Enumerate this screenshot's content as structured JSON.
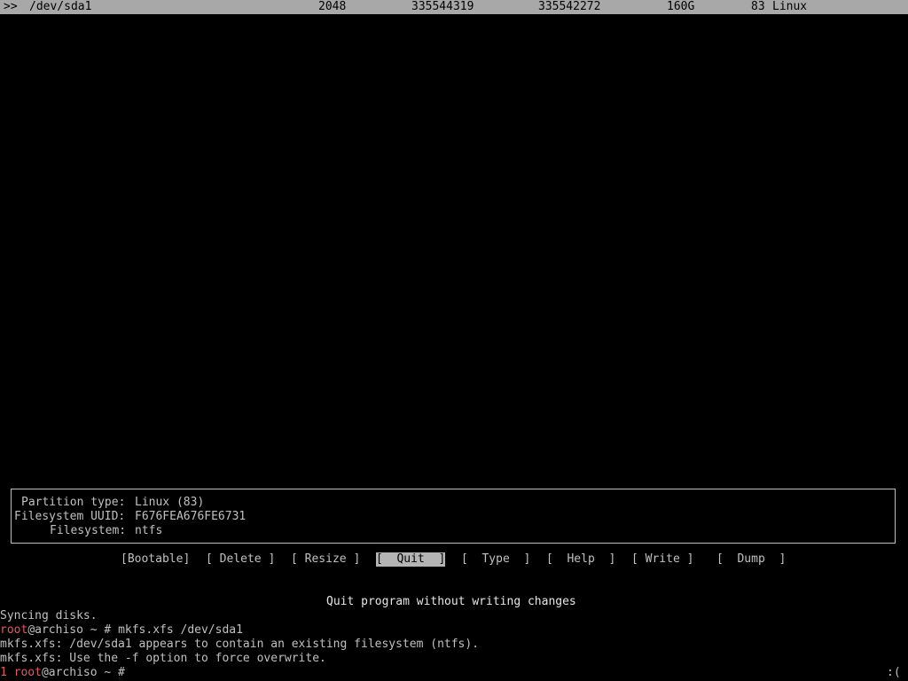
{
  "partition_row": {
    "marker": ">>",
    "device": "/dev/sda1",
    "start": "2048",
    "end": "335544319",
    "sectors": "335542272",
    "size": "160G",
    "id": "83",
    "type": "Linux"
  },
  "info": {
    "partition_type_label": "Partition type:",
    "partition_type_value": "Linux (83)",
    "uuid_label": "Filesystem UUID:",
    "uuid_value": "F676FEA676FE6731",
    "fs_label": "Filesystem:",
    "fs_value": "ntfs"
  },
  "menu": {
    "items": [
      {
        "label": "[Bootable]",
        "selected": false
      },
      {
        "label": "[ Delete ]",
        "selected": false
      },
      {
        "label": "[ Resize ]",
        "selected": false
      },
      {
        "label": "[  Quit  ]",
        "selected": true
      },
      {
        "label": "[  Type  ]",
        "selected": false
      },
      {
        "label": "[  Help  ]",
        "selected": false
      },
      {
        "label": "[ Write ]",
        "selected": false
      },
      {
        "label": "[  Dump  ]",
        "selected": false
      }
    ],
    "hint": "Quit program without writing changes"
  },
  "terminal": {
    "line1": "Syncing disks.",
    "prompt_user": "root",
    "prompt_host": "@archiso ~ # ",
    "command": "mkfs.xfs /dev/sda1",
    "err1": "mkfs.xfs: /dev/sda1 appears to contain an existing filesystem (ntfs).",
    "err2": "mkfs.xfs: Use the -f option to force overwrite.",
    "last_status": "1 ",
    "last_user": "root",
    "last_host": "@archiso ~ # ",
    "status_right": ":("
  },
  "colors": {
    "background": "#000000",
    "text": "#c0c0c0",
    "highlight": "#a8a8a8",
    "prompt_red": "#e05a5a"
  }
}
